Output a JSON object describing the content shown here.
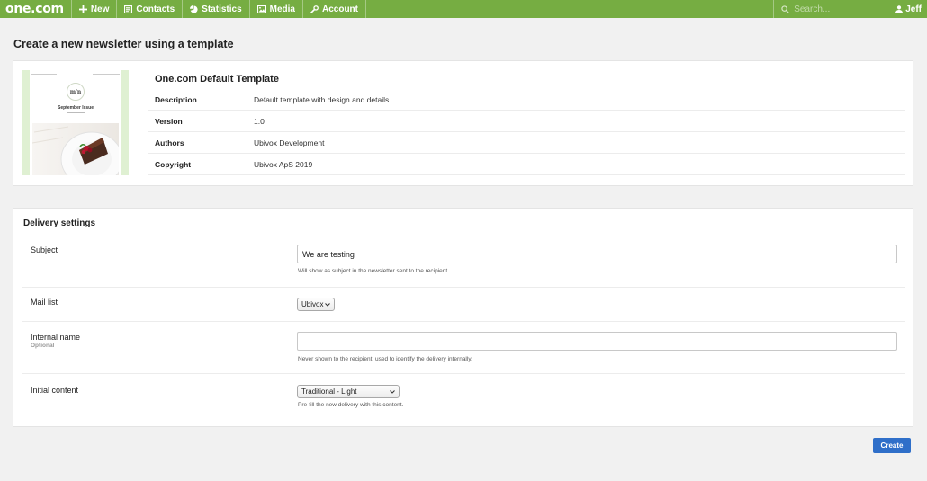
{
  "nav": {
    "logo": "one.com",
    "items": [
      {
        "label": "New",
        "icon": "plus-icon"
      },
      {
        "label": "Contacts",
        "icon": "contacts-icon"
      },
      {
        "label": "Statistics",
        "icon": "pie-chart-icon"
      },
      {
        "label": "Media",
        "icon": "image-icon"
      },
      {
        "label": "Account",
        "icon": "wrench-icon"
      }
    ],
    "search_placeholder": "Search...",
    "user": "Jeff"
  },
  "page_title": "Create a new newsletter using a template",
  "template": {
    "name": "One.com Default Template",
    "thumbnail": {
      "logo_text": "m'n",
      "issue_title": "September Issue"
    },
    "rows": [
      {
        "key": "Description",
        "value": "Default template with design and details."
      },
      {
        "key": "Version",
        "value": "1.0"
      },
      {
        "key": "Authors",
        "value": "Ubivox Development"
      },
      {
        "key": "Copyright",
        "value": "Ubivox ApS 2019"
      }
    ]
  },
  "delivery": {
    "title": "Delivery settings",
    "subject": {
      "label": "Subject",
      "value": "We are testing",
      "help": "Will show as subject in the newsletter sent to the recipient"
    },
    "mail_list": {
      "label": "Mail list",
      "selected": "Ubivox"
    },
    "internal_name": {
      "label": "Internal name",
      "sublabel": "Optional",
      "value": "",
      "help": "Never shown to the recipient, used to identify the delivery internally."
    },
    "initial_content": {
      "label": "Initial content",
      "selected": "Traditional - Light",
      "help": "Pre-fill the new delivery with this content."
    }
  },
  "create_label": "Create",
  "colors": {
    "nav_green": "#76ad42",
    "button_blue": "#2f6fc9",
    "page_bg": "#f1f1f1"
  }
}
